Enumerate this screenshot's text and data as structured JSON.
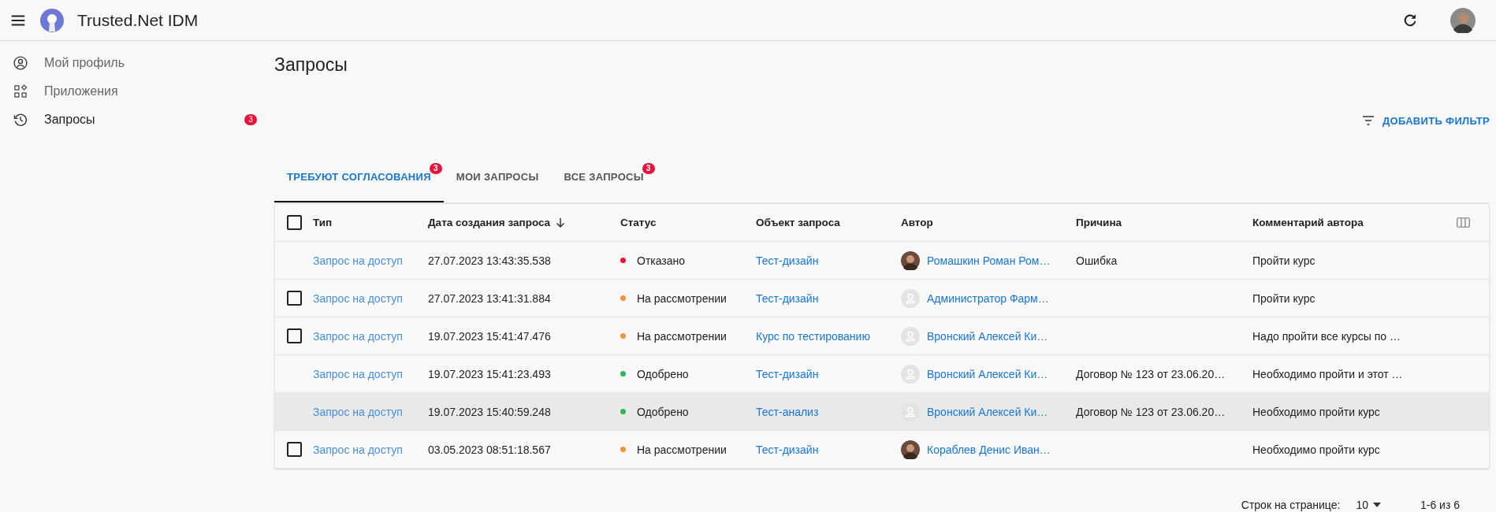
{
  "app_bar": {
    "title": "Trusted.Net IDM"
  },
  "sidebar": {
    "items": [
      {
        "label": "Мой профиль",
        "selected": false
      },
      {
        "label": "Приложения",
        "selected": false
      },
      {
        "label": "Запросы",
        "selected": true,
        "badge": "3"
      }
    ]
  },
  "page_title": "Запросы",
  "filter_button": "ДОБАВИТЬ ФИЛЬТР",
  "tabs": [
    {
      "label": "ТРЕБУЮТ СОГЛАСОВАНИЯ",
      "selected": true,
      "badge": "3"
    },
    {
      "label": "МОИ ЗАПРОСЫ",
      "selected": false
    },
    {
      "label": "ВСЕ ЗАПРОСЫ",
      "selected": false,
      "badge": "3"
    }
  ],
  "table": {
    "select_all_checked": false,
    "columns": [
      "Тип",
      "Дата создания запроса",
      "Статус",
      "Объект запроса",
      "Автор",
      "Причина",
      "Комментарий автора"
    ],
    "rows": [
      {
        "selectable": false,
        "highlighted": false,
        "type": "Запрос на доступ",
        "date": "27.07.2023 13:43:35.538",
        "status": "Отказано",
        "color": "#e8133b",
        "object": "Тест-дизайн",
        "author": {
          "kind": "photo",
          "name": "Ромашкин Роман Ром…"
        },
        "reason": "Ошибка",
        "comment": "Пройти курс"
      },
      {
        "selectable": true,
        "checked": false,
        "highlighted": false,
        "type": "Запрос на доступ",
        "date": "27.07.2023 13:41:31.884",
        "status": "На рассмотрении",
        "color": "#f0923a",
        "object": "Тест-дизайн",
        "author": {
          "kind": "placeholder",
          "name": "Администратор Фарм…"
        },
        "comment": "Пройти курс"
      },
      {
        "selectable": true,
        "checked": false,
        "highlighted": false,
        "type": "Запрос на доступ",
        "date": "19.07.2023 15:41:47.476",
        "status": "На рассмотрении",
        "color": "#f0923a",
        "object": "Курс по тестированию",
        "author": {
          "kind": "placeholder",
          "name": "Вронский Алексей Ки…"
        },
        "comment": "Надо пройти все курсы по …"
      },
      {
        "selectable": false,
        "highlighted": false,
        "type": "Запрос на доступ",
        "date": "19.07.2023 15:41:23.493",
        "status": "Одобрено",
        "color": "#2fb85a",
        "object": "Тест-дизайн",
        "author": {
          "kind": "placeholder",
          "name": "Вронский Алексей Ки…"
        },
        "reason": "Договор № 123 от 23.06.20…",
        "comment": "Необходимо пройти и этот …"
      },
      {
        "selectable": false,
        "highlighted": true,
        "type": "Запрос на доступ",
        "date": "19.07.2023 15:40:59.248",
        "status": "Одобрено",
        "color": "#2fb85a",
        "object": "Тест-анализ",
        "author": {
          "kind": "placeholder",
          "name": "Вронский Алексей Ки…"
        },
        "reason": "Договор № 123 от 23.06.20…",
        "comment": "Необходимо пройти курс"
      },
      {
        "selectable": true,
        "checked": false,
        "highlighted": false,
        "type": "Запрос на доступ",
        "date": "03.05.2023 08:51:18.567",
        "status": "На рассмотрении",
        "color": "#f0923a",
        "object": "Тест-дизайн",
        "author": {
          "kind": "photo",
          "name": "Кораблев Денис Иван…"
        },
        "comment": "Необходимо пройти курс"
      }
    ]
  },
  "pagination": {
    "rows_per_page_label": "Строк на странице:",
    "rows_per_page": "10",
    "range": "1-6 из 6"
  }
}
